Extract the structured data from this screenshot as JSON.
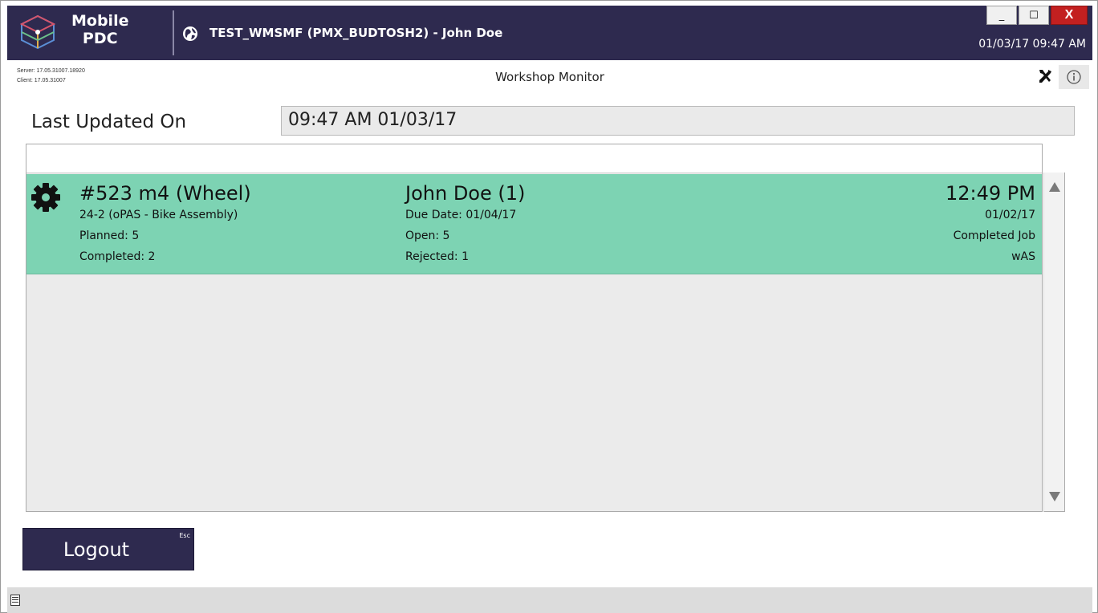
{
  "app": {
    "name_line1": "Mobile",
    "name_line2": "PDC",
    "window_title": "TEST_WMSMF (PMX_BUDTOSH2) - John Doe",
    "datetime": "01/03/17 09:47 AM",
    "window_controls": {
      "minimize": "_",
      "maximize": "☐",
      "close": "X"
    }
  },
  "info": {
    "server": "Server: 17.05.31007.18920",
    "client": "Client: 17.05.31007",
    "screen_title": "Workshop Monitor"
  },
  "last_updated": {
    "label": "Last Updated On",
    "value": "09:47 AM 01/03/17"
  },
  "jobs": [
    {
      "status_icon": "gear-icon",
      "title": "#523 m4 (Wheel)",
      "operation": "24-2 (oPAS - Bike Assembly)",
      "planned": "Planned: 5",
      "completed": "Completed: 2",
      "employee": "John Doe (1)",
      "due_date": "Due Date: 01/04/17",
      "open": "Open: 5",
      "rejected": "Rejected: 1",
      "time": "12:49 PM",
      "date": "01/02/17",
      "status": "Completed Job",
      "code": "wAS",
      "row_color": "#7dd3b3"
    }
  ],
  "buttons": {
    "logout_label": "Logout",
    "logout_hotkey": "Esc"
  },
  "colors": {
    "brand": "#2e2a4f",
    "row_active": "#7dd3b3",
    "close_button": "#c32020"
  }
}
